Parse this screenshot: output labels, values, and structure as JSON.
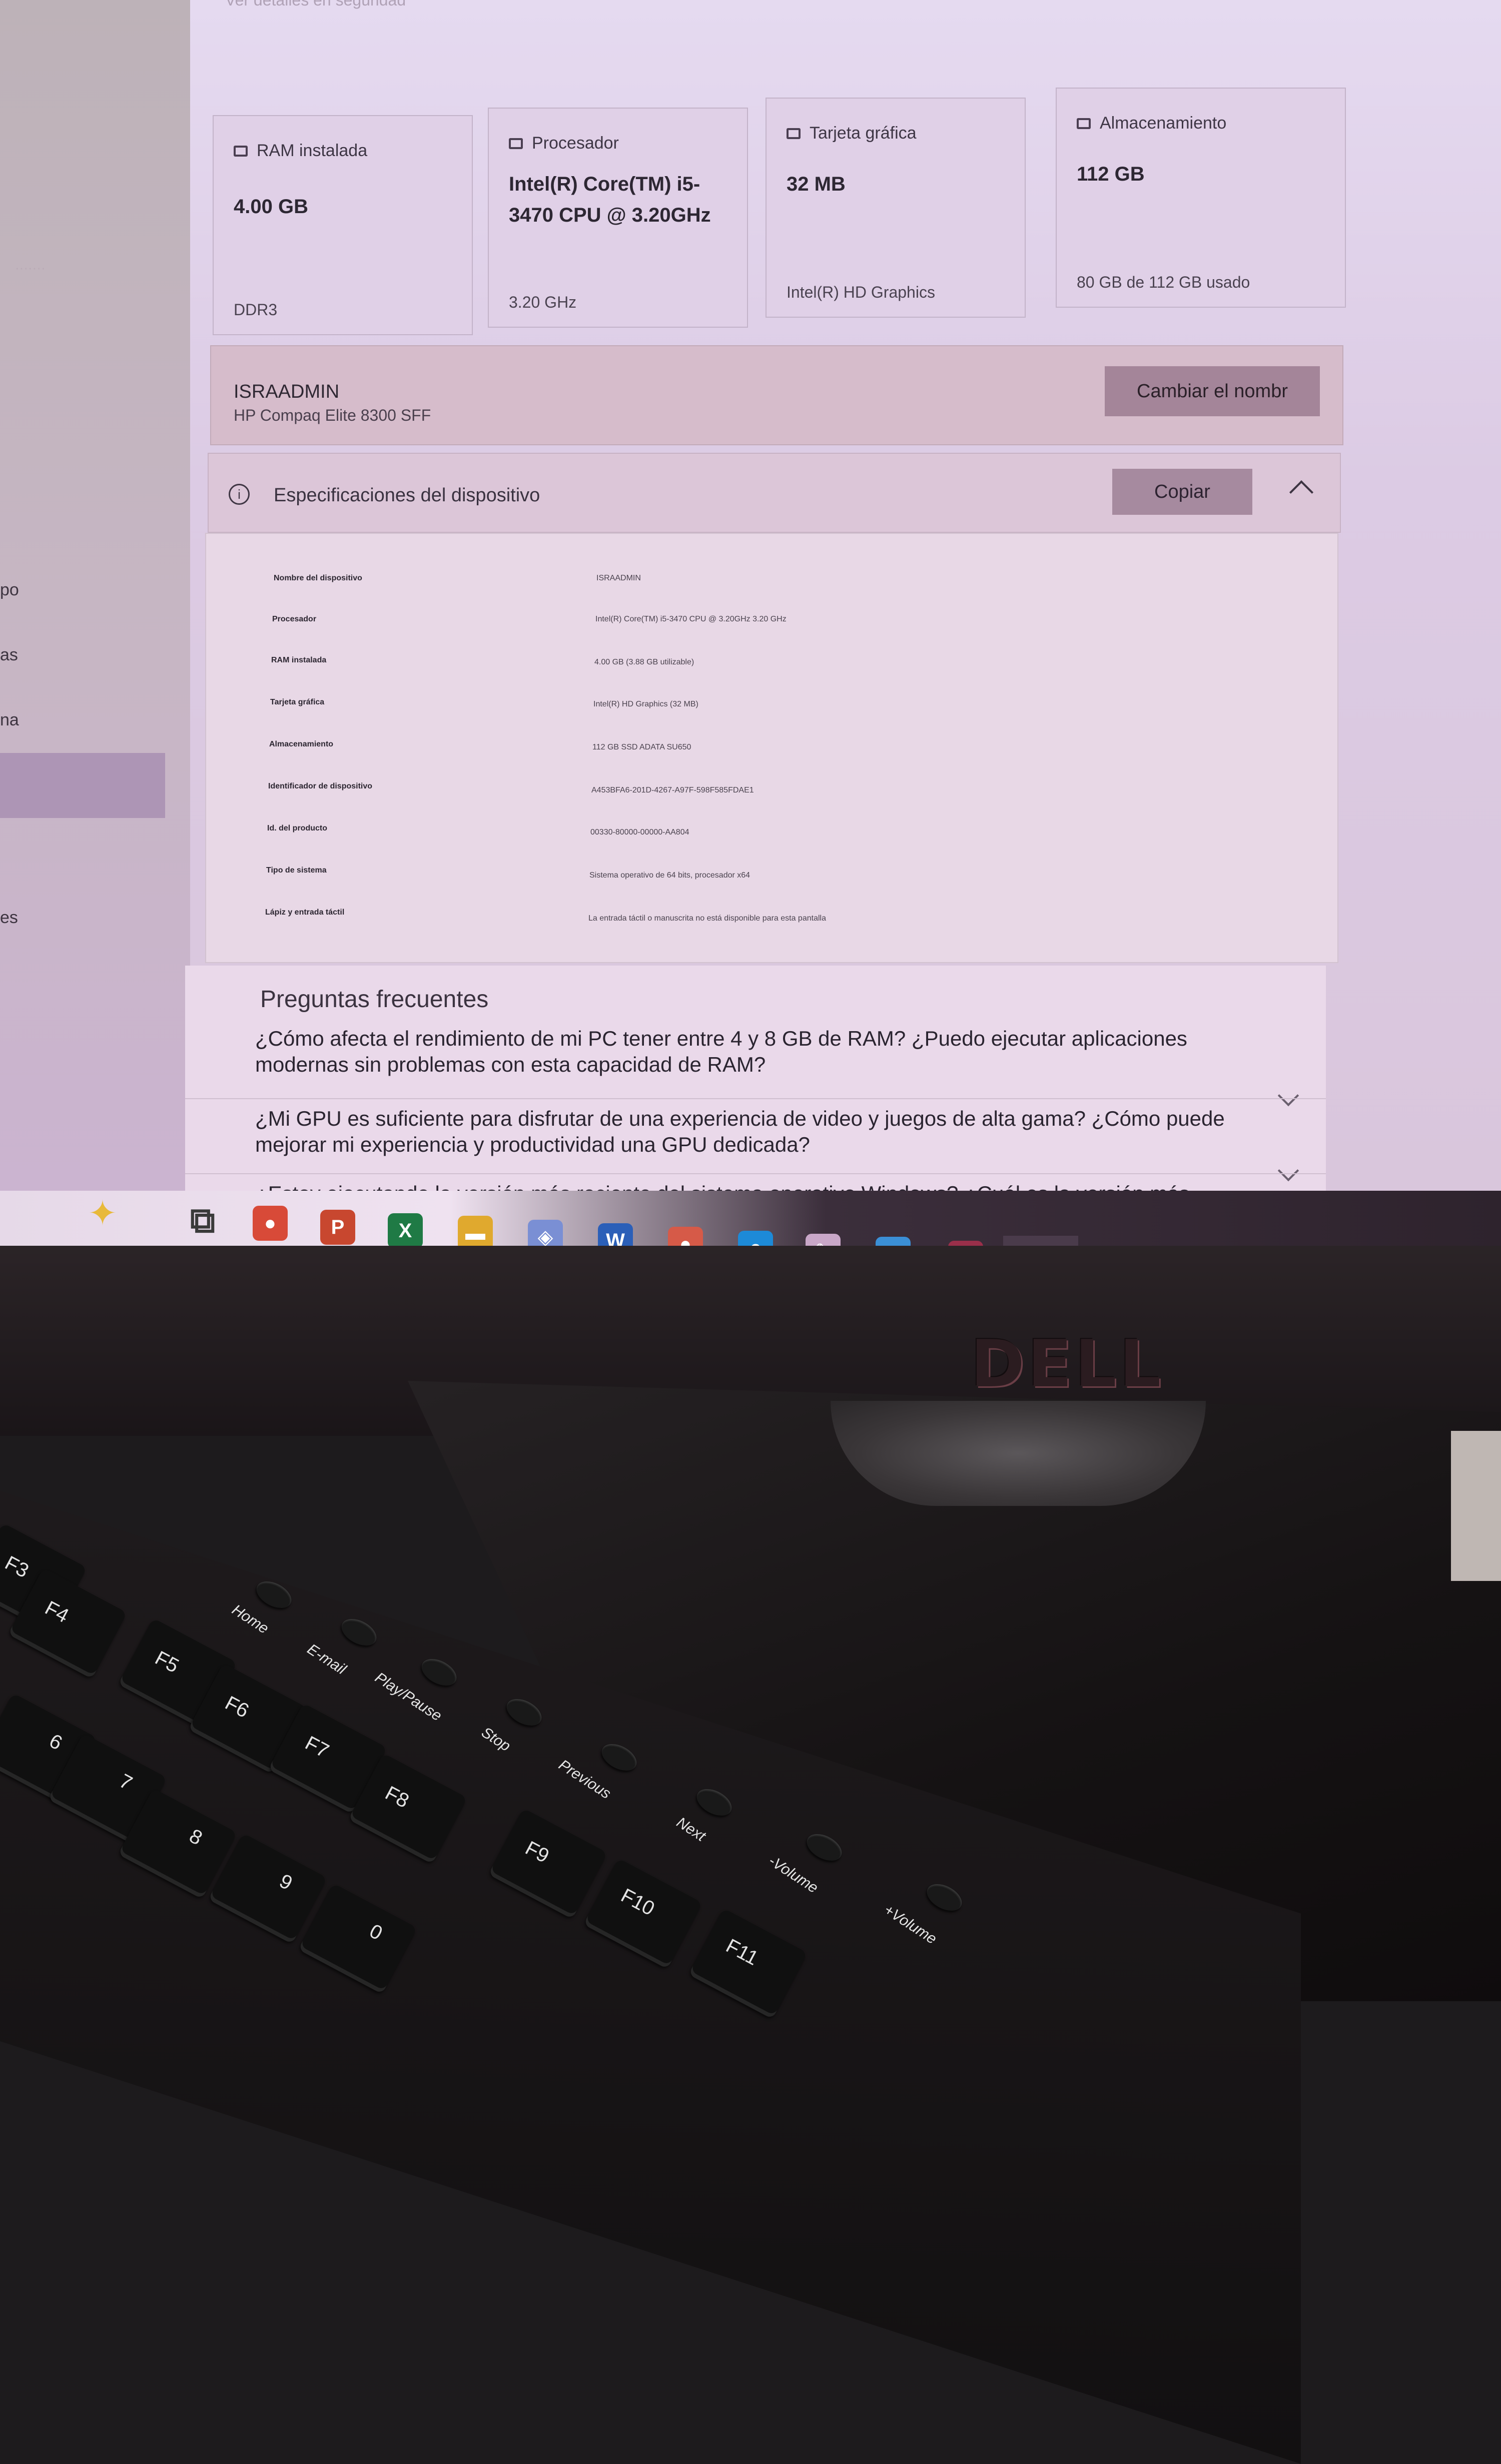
{
  "screen": {
    "top_hint": "Ver detalles en seguridad",
    "sidebar": {
      "items": [
        "po",
        "as",
        "na",
        "es"
      ]
    },
    "cards": [
      {
        "icon": "ram-icon",
        "title": "RAM instalada",
        "value": "4.00 GB",
        "sub": "DDR3"
      },
      {
        "icon": "processor-icon",
        "title": "Procesador",
        "value": "Intel(R) Core(TM) i5-3470 CPU @ 3.20GHz",
        "sub": "3.20 GHz"
      },
      {
        "icon": "graphics-card-icon",
        "title": "Tarjeta gráfica",
        "value": "32 MB",
        "sub": "Intel(R) HD Graphics"
      },
      {
        "icon": "storage-icon",
        "title": "Almacenamiento",
        "value": "112 GB",
        "sub": "80 GB de 112 GB usado"
      }
    ],
    "device": {
      "name": "ISRAADMIN",
      "model": "HP Compaq Elite 8300 SFF",
      "rename_label": "Cambiar el nombr"
    },
    "specs": {
      "title": "Especificaciones del dispositivo",
      "copy_label": "Copiar",
      "rows": [
        {
          "label": "Nombre del dispositivo",
          "value": "ISRAADMIN"
        },
        {
          "label": "Procesador",
          "value": "Intel(R) Core(TM) i5-3470 CPU @ 3.20GHz   3.20 GHz"
        },
        {
          "label": "RAM instalada",
          "value": "4.00 GB (3.88 GB utilizable)"
        },
        {
          "label": "Tarjeta gráfica",
          "value": "Intel(R) HD Graphics (32 MB)"
        },
        {
          "label": "Almacenamiento",
          "value": "112 GB SSD ADATA SU650"
        },
        {
          "label": "Identificador de dispositivo",
          "value": "A453BFA6-201D-4267-A97F-598F585FDAE1"
        },
        {
          "label": "Id. del producto",
          "value": "00330-80000-00000-AA804"
        },
        {
          "label": "Tipo de sistema",
          "value": "Sistema operativo de 64 bits, procesador x64"
        },
        {
          "label": "Lápiz y entrada táctil",
          "value": "La entrada táctil o manuscrita no está disponible para esta pantalla"
        }
      ]
    },
    "faq": {
      "title": "Preguntas frecuentes",
      "items": [
        "¿Cómo afecta el rendimiento de mi PC tener entre 4 y 8 GB de RAM? ¿Puedo ejecutar aplicaciones modernas sin problemas con esta capacidad de RAM?",
        "¿Mi GPU es suficiente para disfrutar de una experiencia de video y juegos de alta gama? ¿Cómo puede mejorar mi experiencia y productividad una GPU dedicada?",
        "¿Estoy ejecutando la versión más reciente del sistema operativo Windows? ¿Cuál es la versión más"
      ]
    },
    "taskbar": {
      "icons": [
        {
          "name": "copilot-icon",
          "glyph": "✦",
          "color": "#e8b93a"
        },
        {
          "name": "task-view-icon",
          "glyph": "⧉",
          "color": "#3a3a3a"
        },
        {
          "name": "chrome-icon",
          "glyph": "●",
          "color": "#d84a38"
        },
        {
          "name": "powerpoint-icon",
          "glyph": "P",
          "color": "#c8472f"
        },
        {
          "name": "excel-icon",
          "glyph": "X",
          "color": "#1f7a45"
        },
        {
          "name": "file-explorer-icon",
          "glyph": "▬",
          "color": "#e0a92e"
        },
        {
          "name": "photo-app-icon",
          "glyph": "◈",
          "color": "#7a8fd4"
        },
        {
          "name": "word-icon",
          "glyph": "W",
          "color": "#2b5fb8"
        },
        {
          "name": "chrome-profile-icon",
          "glyph": "●",
          "color": "#d65a48"
        },
        {
          "name": "edge-icon",
          "glyph": "e",
          "color": "#1d8ad8"
        },
        {
          "name": "paint-icon",
          "glyph": "✎",
          "color": "#c9a7c8"
        },
        {
          "name": "photos-icon",
          "glyph": "▲",
          "color": "#3b8fd6"
        },
        {
          "name": "winrar-icon",
          "glyph": "▦",
          "color": "#9a2f4a"
        },
        {
          "name": "settings-icon",
          "glyph": "⚙",
          "color": "#4a3b4b"
        }
      ]
    }
  },
  "hardware": {
    "brand_logo": "DELL",
    "function_keys": [
      "F3",
      "F4",
      "F5",
      "F6",
      "F7",
      "F8",
      "F9",
      "F10",
      "F11"
    ],
    "number_keys": [
      "6",
      "7",
      "8",
      "9",
      "0"
    ],
    "media_keys": [
      "Home",
      "E-mail",
      "Play/Pause",
      "Stop",
      "Previous",
      "Next",
      "-Volume",
      "+Volume"
    ]
  }
}
